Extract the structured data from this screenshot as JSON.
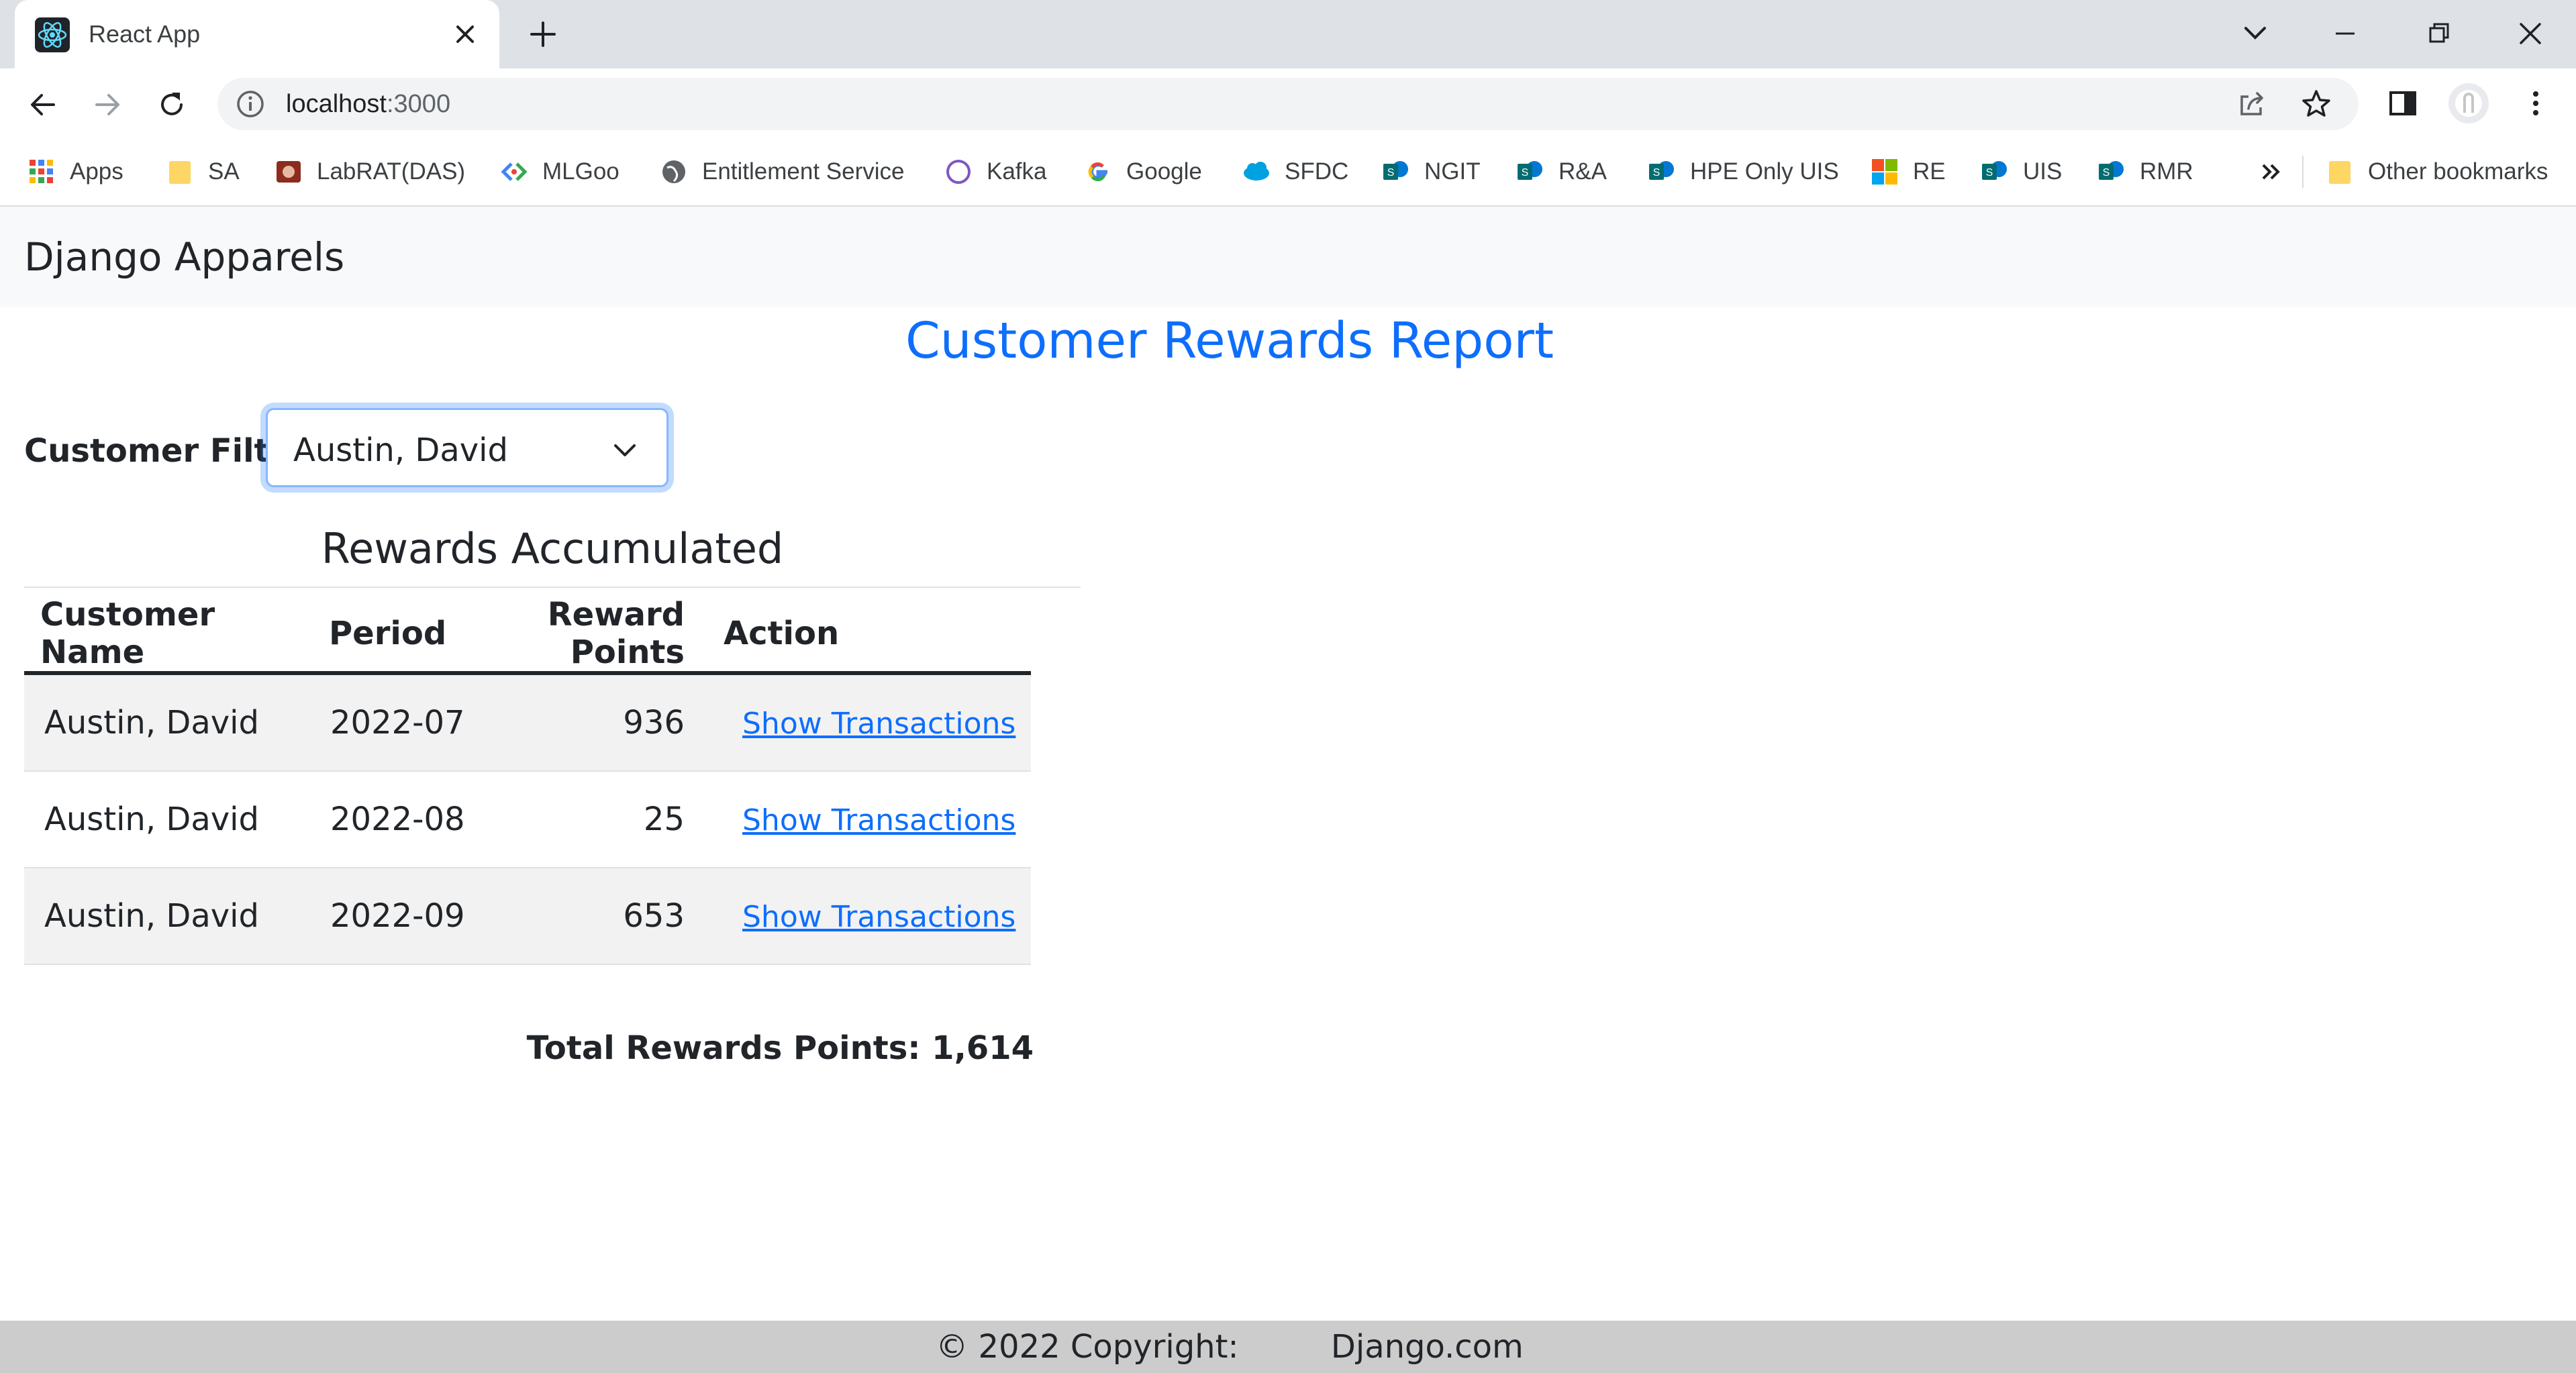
{
  "browser": {
    "tab_title": "React App",
    "url_host": "localhost",
    "url_port": ":3000",
    "bookmarks": [
      {
        "label": "Apps",
        "icon": "apps-grid-icon"
      },
      {
        "label": "SA",
        "icon": "folder-icon"
      },
      {
        "label": "LabRAT(DAS)",
        "icon": "labrat-icon"
      },
      {
        "label": "MLGoo",
        "icon": "mlgoo-icon"
      },
      {
        "label": "Entitlement Service",
        "icon": "globe-icon"
      },
      {
        "label": "Kafka",
        "icon": "kafka-icon"
      },
      {
        "label": "Google",
        "icon": "google-icon"
      },
      {
        "label": "SFDC",
        "icon": "salesforce-cloud-icon"
      },
      {
        "label": "NGIT",
        "icon": "sharepoint-icon"
      },
      {
        "label": "R&A",
        "icon": "sharepoint-icon"
      },
      {
        "label": "HPE Only UIS",
        "icon": "sharepoint-icon"
      },
      {
        "label": "RE",
        "icon": "microsoft-icon"
      },
      {
        "label": "UIS",
        "icon": "sharepoint-icon"
      },
      {
        "label": "RMR",
        "icon": "sharepoint-icon"
      }
    ],
    "other_bookmarks": "Other bookmarks"
  },
  "navbar": {
    "brand": "Django Apparels"
  },
  "page": {
    "title": "Customer Rewards Report",
    "filter_label": "Customer Filter",
    "filter_selected": "Austin, David",
    "section_title": "Rewards Accumulated",
    "total_label": "Total Rewards Points: 1,614"
  },
  "table": {
    "headers": [
      "Customer Name",
      "Period",
      "Reward Points",
      "Action"
    ],
    "rows": [
      {
        "name": "Austin, David",
        "period": "2022-07",
        "points": "936",
        "action": "Show Transactions"
      },
      {
        "name": "Austin, David",
        "period": "2022-08",
        "points": "25",
        "action": "Show Transactions"
      },
      {
        "name": "Austin, David",
        "period": "2022-09",
        "points": "653",
        "action": "Show Transactions"
      }
    ]
  },
  "footer": {
    "text": "© 2022 Copyright:         Django.com"
  },
  "colors": {
    "accent": "#0d6efd",
    "footer_bg": "#cccccc",
    "navbar_bg": "#f8f9fa",
    "stripe": "#f2f2f2"
  }
}
